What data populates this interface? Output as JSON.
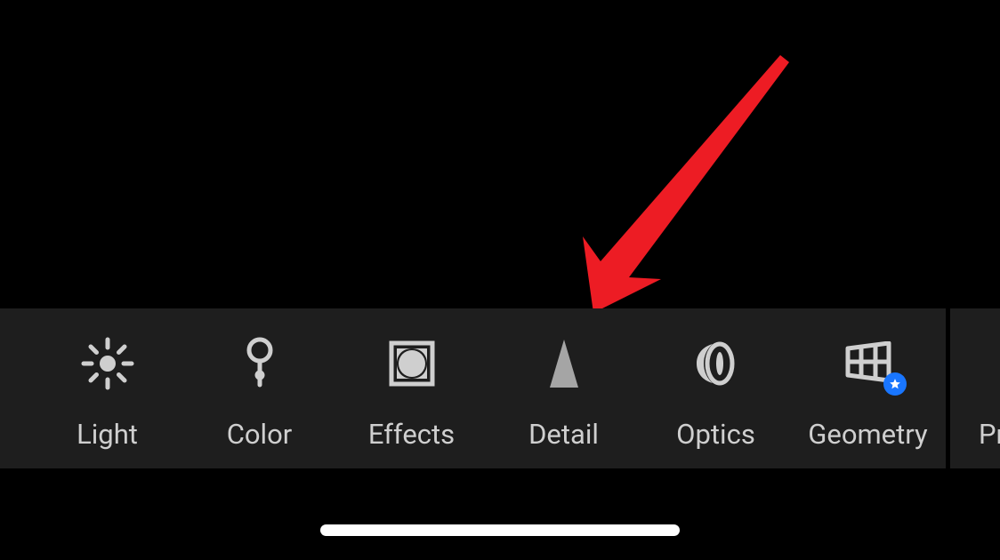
{
  "toolbar": {
    "items": [
      {
        "label": "Light"
      },
      {
        "label": "Color"
      },
      {
        "label": "Effects"
      },
      {
        "label": "Detail"
      },
      {
        "label": "Optics"
      },
      {
        "label": "Geometry"
      }
    ],
    "partial_label": "Pr"
  },
  "annotation": {
    "arrow_color": "#ed1c24"
  }
}
